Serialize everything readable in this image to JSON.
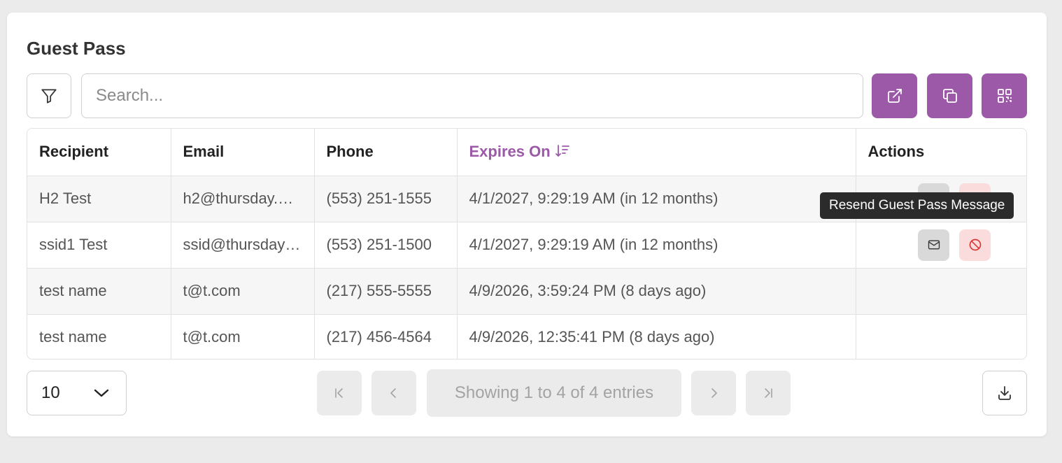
{
  "page": {
    "title": "Guest Pass"
  },
  "search": {
    "placeholder": "Search...",
    "value": ""
  },
  "toolbar": {
    "filter_icon": "filter-icon",
    "buttons": [
      "external-link-icon",
      "copy-icon",
      "qr-code-icon"
    ],
    "accent": "#9b59a8"
  },
  "table": {
    "columns": [
      "Recipient",
      "Email",
      "Phone",
      "Expires On",
      "Actions"
    ],
    "sorted_column": "Expires On",
    "sort_direction": "descending",
    "rows": [
      {
        "recipient": "H2 Test",
        "email": "h2@thursday.…",
        "phone": "(553) 251-1555",
        "expires": "4/1/2027, 9:29:19 AM (in 12 months)"
      },
      {
        "recipient": "ssid1 Test",
        "email": "ssid@thursday…",
        "phone": "(553) 251-1500",
        "expires": "4/1/2027, 9:29:19 AM (in 12 months)"
      },
      {
        "recipient": "test name",
        "email": "t@t.com",
        "phone": "(217) 555-5555",
        "expires": "4/9/2026, 3:59:24 PM (8 days ago)"
      },
      {
        "recipient": "test name",
        "email": "t@t.com",
        "phone": "(217) 456-4564",
        "expires": "4/9/2026, 12:35:41 PM (8 days ago)"
      }
    ]
  },
  "tooltip": {
    "text": "Resend Guest Pass Message"
  },
  "pagination": {
    "page_size": "10",
    "showing": "Showing 1 to 4 of 4 entries"
  }
}
